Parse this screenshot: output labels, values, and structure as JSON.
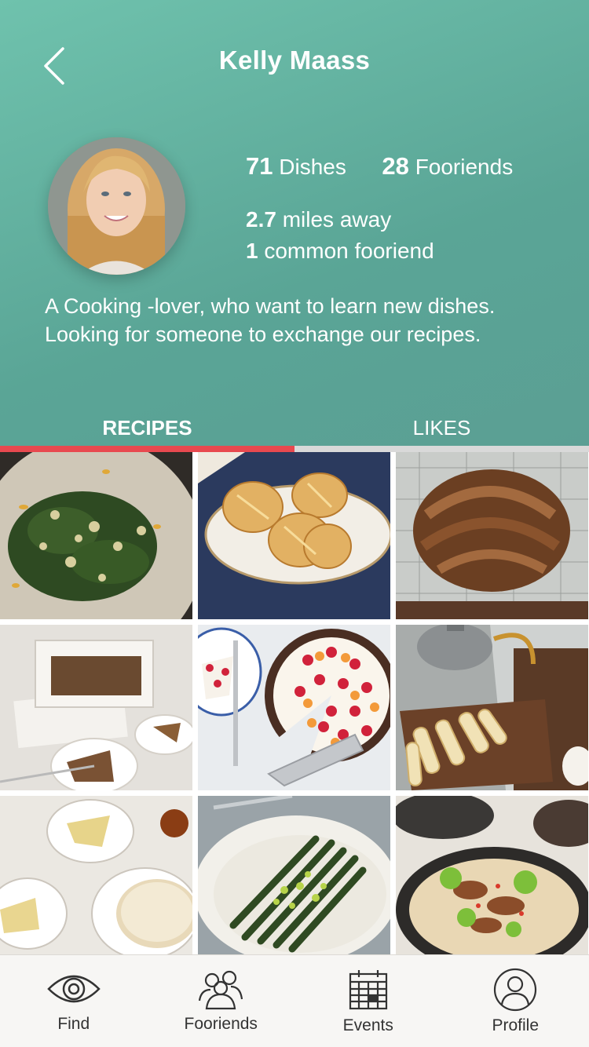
{
  "header": {
    "title": "Kelly Maass",
    "back_icon": "chevron-left-icon"
  },
  "stats": {
    "dishes_count": "71",
    "dishes_label": "Dishes",
    "fooriends_count": "28",
    "fooriends_label": "Fooriends",
    "distance_value": "2.7",
    "distance_label": "miles away",
    "common_value": "1",
    "common_label": "common fooriend"
  },
  "bio": {
    "line1": "A Cooking -lover, who want to learn new dishes.",
    "line2": "Looking for someone to exchange our recipes."
  },
  "tabs": [
    {
      "label": "RECIPES",
      "active": true
    },
    {
      "label": "LIKES",
      "active": false
    }
  ],
  "recipes": [
    {
      "name": "kale-quinoa-salad"
    },
    {
      "name": "hasselback-potatoes"
    },
    {
      "name": "cinnamon-babka"
    },
    {
      "name": "loaf-cake"
    },
    {
      "name": "berry-tart"
    },
    {
      "name": "rolled-wafer-cookies"
    },
    {
      "name": "lemon-tart"
    },
    {
      "name": "asparagus-gremolata"
    },
    {
      "name": "mushroom-noodle-bowl"
    }
  ],
  "nav": [
    {
      "label": "Find",
      "icon": "eye-icon"
    },
    {
      "label": "Fooriends",
      "icon": "people-icon"
    },
    {
      "label": "Events",
      "icon": "calendar-icon"
    },
    {
      "label": "Profile",
      "icon": "user-icon"
    }
  ],
  "colors": {
    "header_bg": "#5fa99a",
    "accent": "#e8494f",
    "nav_bg": "#f7f6f4"
  }
}
